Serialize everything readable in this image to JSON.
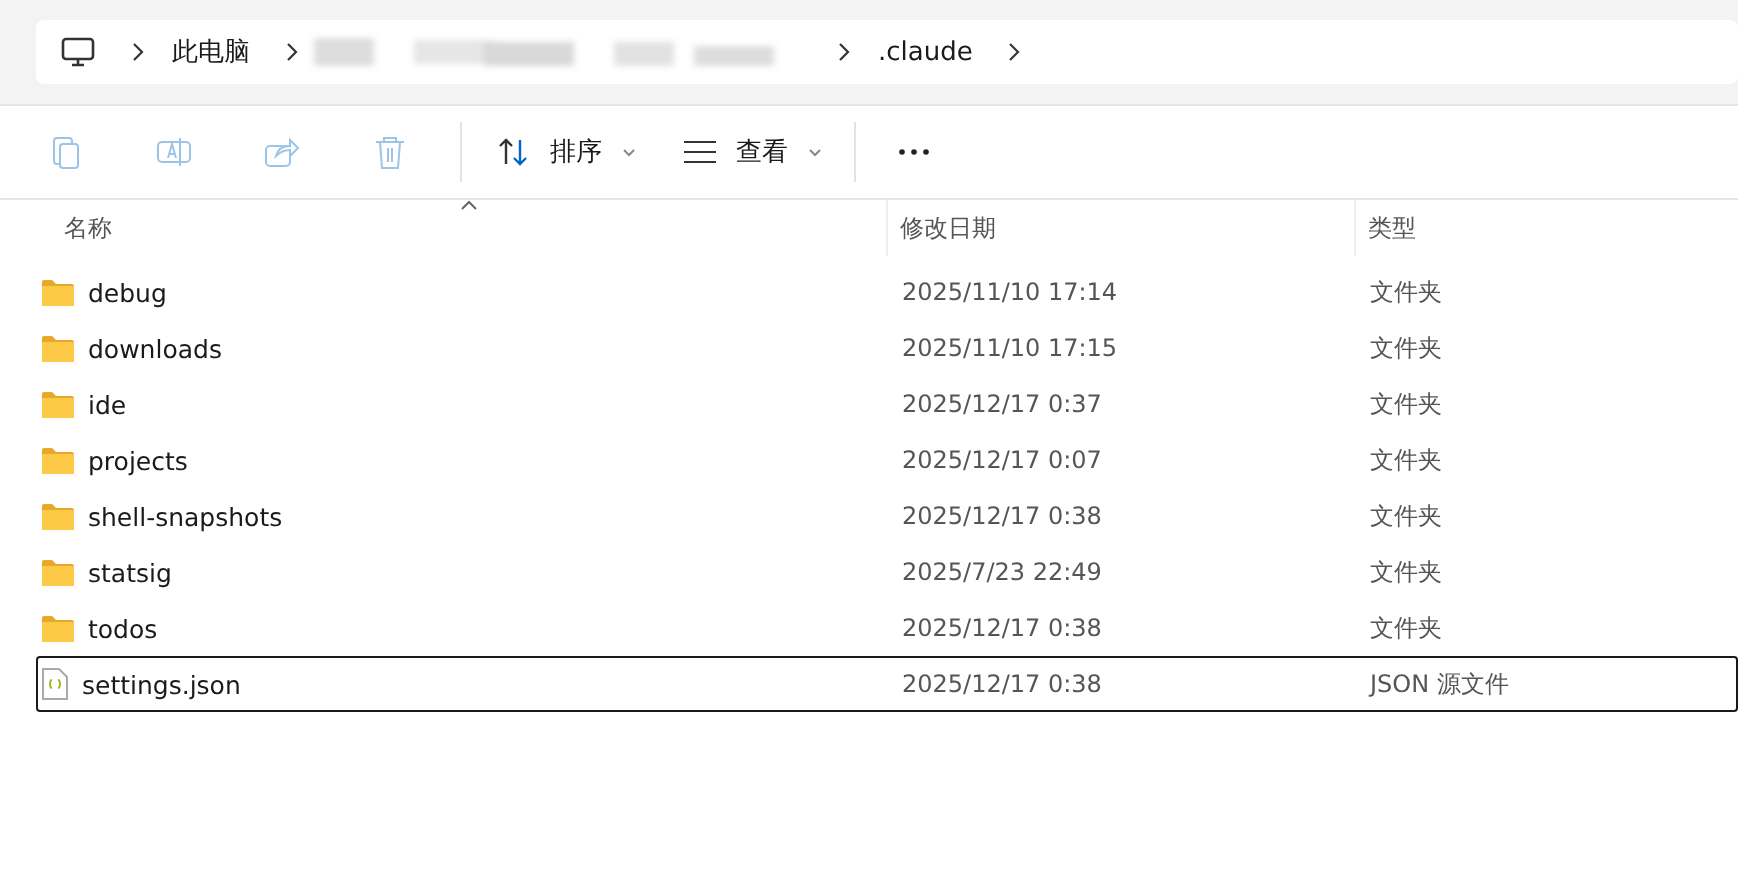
{
  "breadcrumb": [
    {
      "label": "此电脑",
      "kind": "text"
    },
    {
      "kind": "redacted"
    },
    {
      "label": ".claude",
      "kind": "text"
    }
  ],
  "toolbar": [
    {
      "kind": "copy",
      "disabled": true
    },
    {
      "kind": "rename",
      "disabled": true
    },
    {
      "kind": "share",
      "disabled": true
    },
    {
      "kind": "delete",
      "disabled": true
    },
    {
      "kind": "sort",
      "label": "排序",
      "disabled": false
    },
    {
      "kind": "view",
      "label": "查看",
      "disabled": false
    },
    {
      "kind": "more",
      "disabled": false
    }
  ],
  "table": {
    "columns": [
      "名称",
      "修改日期",
      "类型"
    ],
    "rows": [
      {
        "name": "debug",
        "date": "2025/11/10 17:14",
        "type": "文件夹",
        "kind": "folder",
        "focused": false
      },
      {
        "name": "downloads",
        "date": "2025/11/10 17:15",
        "type": "文件夹",
        "kind": "folder",
        "focused": false
      },
      {
        "name": "ide",
        "date": "2025/12/17 0:37",
        "type": "文件夹",
        "kind": "folder",
        "focused": false
      },
      {
        "name": "projects",
        "date": "2025/12/17 0:07",
        "type": "文件夹",
        "kind": "folder",
        "focused": false
      },
      {
        "name": "shell-snapshots",
        "date": "2025/12/17 0:38",
        "type": "文件夹",
        "kind": "folder",
        "focused": false
      },
      {
        "name": "statsig",
        "date": "2025/7/23 22:49",
        "type": "文件夹",
        "kind": "folder",
        "focused": false
      },
      {
        "name": "todos",
        "date": "2025/12/17 0:38",
        "type": "文件夹",
        "kind": "folder",
        "focused": false
      },
      {
        "name": "settings.json",
        "date": "2025/12/17 0:38",
        "type": "JSON 源文件",
        "kind": "json",
        "focused": true
      }
    ]
  }
}
